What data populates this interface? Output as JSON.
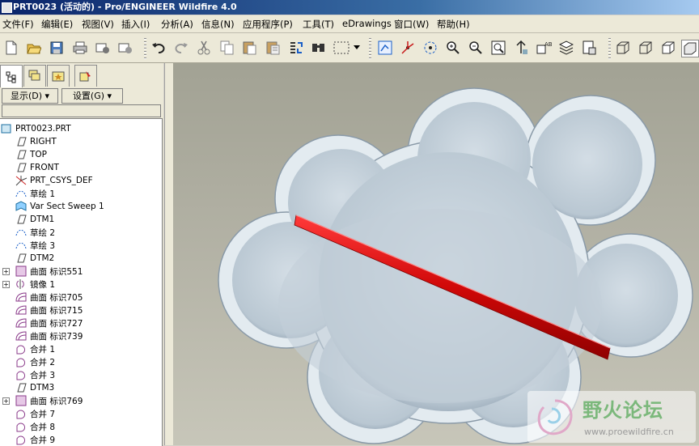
{
  "window": {
    "title": "PRT0023 (活动的) - Pro/ENGINEER Wildfire 4.0"
  },
  "menu": [
    "文件(F)",
    "编辑(E)",
    "视图(V)",
    "插入(I)",
    "分析(A)",
    "信息(N)",
    "应用程序(P)",
    "工具(T)",
    "eDrawings",
    "窗口(W)",
    "帮助(H)"
  ],
  "toolbar": {
    "icons": [
      "new-file-icon",
      "open-folder-icon",
      "save-icon",
      "print-icon",
      "send-mail-icon",
      "send-mail-icon",
      "undo-icon",
      "redo-icon",
      "cut-icon",
      "copy-icon",
      "paste-icon",
      "paste-special-icon",
      "regenerate-icon",
      "find-icon",
      "select-box-icon",
      "dropdown-arrow-icon",
      "repaint-icon",
      "spin-center-icon",
      "orient-mode-icon",
      "zoom-in-icon",
      "zoom-out-icon",
      "refit-icon",
      "reorient-icon",
      "saved-views-icon",
      "layers-icon",
      "view-manager-icon",
      "wireframe-icon",
      "hidden-line-icon",
      "no-hidden-icon",
      "shading-icon"
    ]
  },
  "panel": {
    "tabs": [
      "model-tree-icon",
      "layer-tree-icon",
      "favorites-icon",
      "connections-icon"
    ],
    "show_button": "显示(D) ▾",
    "settings_button": "设置(G) ▾"
  },
  "tree": [
    {
      "label": "PRT0023.PRT",
      "icon": "part-icon"
    },
    {
      "label": "RIGHT",
      "icon": "datum-plane-icon"
    },
    {
      "label": "TOP",
      "icon": "datum-plane-icon"
    },
    {
      "label": "FRONT",
      "icon": "datum-plane-icon"
    },
    {
      "label": "PRT_CSYS_DEF",
      "icon": "csys-icon"
    },
    {
      "label": "草绘 1",
      "icon": "sketch-icon"
    },
    {
      "label": "Var Sect Sweep 1",
      "icon": "sweep-icon"
    },
    {
      "label": "DTM1",
      "icon": "datum-plane-icon"
    },
    {
      "label": "草绘 2",
      "icon": "sketch-icon"
    },
    {
      "label": "草绘 3",
      "icon": "sketch-icon"
    },
    {
      "label": "DTM2",
      "icon": "datum-plane-icon"
    },
    {
      "label": "曲面 标识551",
      "icon": "surface-icon",
      "expandable": true
    },
    {
      "label": "镜像 1",
      "icon": "mirror-icon",
      "expandable": true
    },
    {
      "label": "曲面 标识705",
      "icon": "quilt-icon"
    },
    {
      "label": "曲面 标识715",
      "icon": "quilt-icon"
    },
    {
      "label": "曲面 标识727",
      "icon": "quilt-icon"
    },
    {
      "label": "曲面 标识739",
      "icon": "quilt-icon"
    },
    {
      "label": "合并 1",
      "icon": "merge-icon"
    },
    {
      "label": "合并 2",
      "icon": "merge-icon"
    },
    {
      "label": "合并 3",
      "icon": "merge-icon"
    },
    {
      "label": "DTM3",
      "icon": "datum-plane-icon"
    },
    {
      "label": "曲面 标识769",
      "icon": "surface-icon",
      "expandable": true
    },
    {
      "label": "合并 7",
      "icon": "merge-icon"
    },
    {
      "label": "合并 8",
      "icon": "merge-icon"
    },
    {
      "label": "合并 9",
      "icon": "merge-icon"
    }
  ],
  "watermark": {
    "title": "野火论坛",
    "url": "www.proewildfire.cn"
  },
  "colors": {
    "accent": "#0a246a",
    "model": "#c6d3dd",
    "highlight": "#e0100e"
  }
}
